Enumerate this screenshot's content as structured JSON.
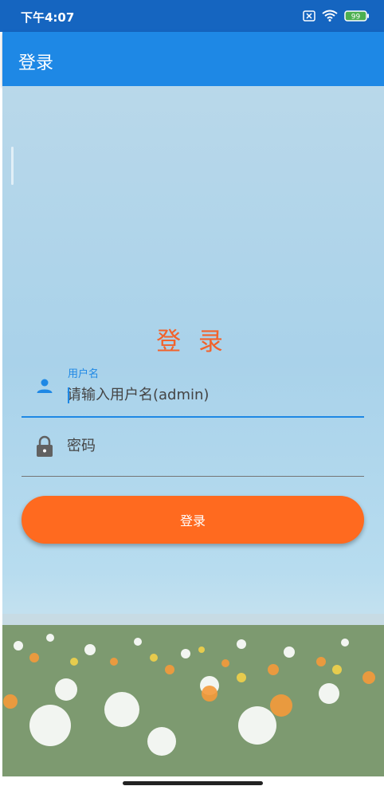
{
  "status_bar": {
    "time": "下午4:07",
    "battery": "99"
  },
  "app_bar": {
    "title": "登录"
  },
  "form": {
    "heading": "登 录",
    "username": {
      "label": "用户名",
      "placeholder": "请输入用户名(admin)"
    },
    "password": {
      "placeholder": "密码"
    },
    "submit_label": "登录"
  },
  "colors": {
    "status_bar": "#1565C0",
    "app_bar": "#1E88E5",
    "accent": "#1E88E5",
    "heading": "#F2622B",
    "button": "#FF6A1F"
  },
  "icons": {
    "user": "person-icon",
    "password": "lock-icon",
    "status": [
      "notification-x-icon",
      "wifi-icon",
      "battery-icon"
    ]
  }
}
